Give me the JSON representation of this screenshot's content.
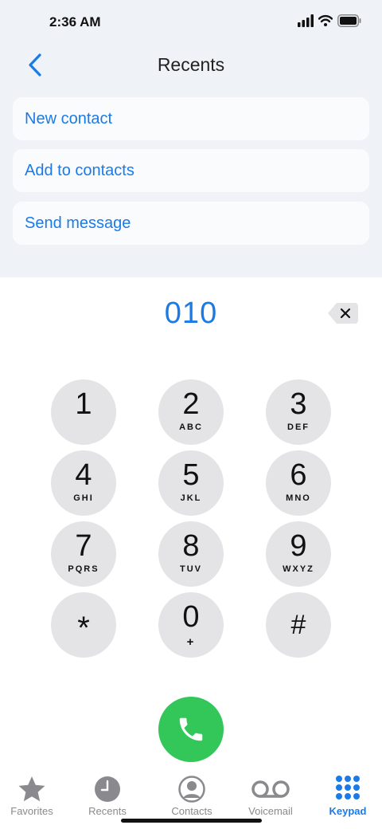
{
  "status": {
    "time": "2:36 AM"
  },
  "nav": {
    "title": "Recents"
  },
  "actions": [
    {
      "label": "New contact"
    },
    {
      "label": "Add to contacts"
    },
    {
      "label": "Send message"
    }
  ],
  "dial": {
    "number": "010"
  },
  "keys": [
    {
      "digit": "1",
      "letters": ""
    },
    {
      "digit": "2",
      "letters": "ABC"
    },
    {
      "digit": "3",
      "letters": "DEF"
    },
    {
      "digit": "4",
      "letters": "GHI"
    },
    {
      "digit": "5",
      "letters": "JKL"
    },
    {
      "digit": "6",
      "letters": "MNO"
    },
    {
      "digit": "7",
      "letters": "PQRS"
    },
    {
      "digit": "8",
      "letters": "TUV"
    },
    {
      "digit": "9",
      "letters": "WXYZ"
    },
    {
      "digit": "*",
      "letters": ""
    },
    {
      "digit": "0",
      "letters": "+"
    },
    {
      "digit": "#",
      "letters": ""
    }
  ],
  "tabs": [
    {
      "label": "Favorites",
      "icon": "star-icon"
    },
    {
      "label": "Recents",
      "icon": "clock-icon"
    },
    {
      "label": "Contacts",
      "icon": "person-icon"
    },
    {
      "label": "Voicemail",
      "icon": "voicemail-icon"
    },
    {
      "label": "Keypad",
      "icon": "keypad-icon",
      "active": true
    }
  ],
  "colors": {
    "accent": "#1a7be6",
    "call": "#33c759",
    "key": "#e4e4e6",
    "inactive": "#8a8a8e"
  }
}
